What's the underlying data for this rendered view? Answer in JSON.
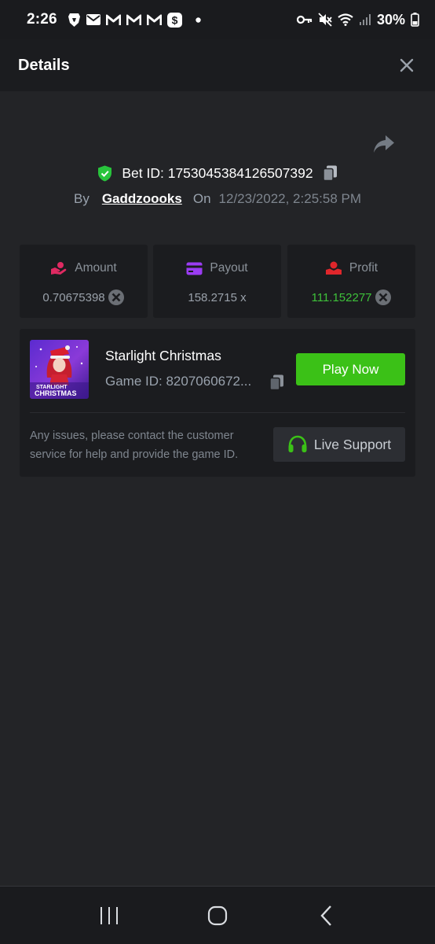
{
  "status_bar": {
    "time": "2:26",
    "battery_percent": "30%",
    "icons_left": [
      "brave-icon",
      "mail-icon",
      "gmail-icon",
      "gmail-icon",
      "gmail-icon",
      "cash-app-icon",
      "dot-icon"
    ],
    "icons_right": [
      "key-icon",
      "mute-icon",
      "wifi-icon",
      "signal-icon",
      "battery-icon"
    ]
  },
  "header": {
    "title": "Details",
    "close_icon": "close-icon"
  },
  "bet": {
    "bet_id_label": "Bet ID: 1753045384126507392",
    "by_label": "By",
    "username": "Gaddzoooks",
    "on_label": "On",
    "date": "12/23/2022, 2:25:58 PM"
  },
  "stats": [
    {
      "label": "Amount",
      "value": "0.70675398",
      "icon": "amount-icon",
      "has_coin": true
    },
    {
      "label": "Payout",
      "value": "158.2715 x",
      "icon": "card-icon",
      "has_coin": false
    },
    {
      "label": "Profit",
      "value": "111.152277",
      "icon": "profit-icon",
      "has_coin": true
    }
  ],
  "game": {
    "title": "Starlight Christmas",
    "game_id": "Game ID: 8207060672...",
    "thumb_text_line1": "STARLIGHT",
    "thumb_text_line2": "CHRISTMAS",
    "play_label": "Play Now",
    "issue_text": "Any issues, please contact the customer service for help and provide the game ID.",
    "support_label": "Live Support"
  },
  "colors": {
    "background": "#232427",
    "panel": "#1b1c1f",
    "accent_green": "#3bc117",
    "profit_green": "#3ec13a",
    "shield_green": "#28c43c"
  }
}
